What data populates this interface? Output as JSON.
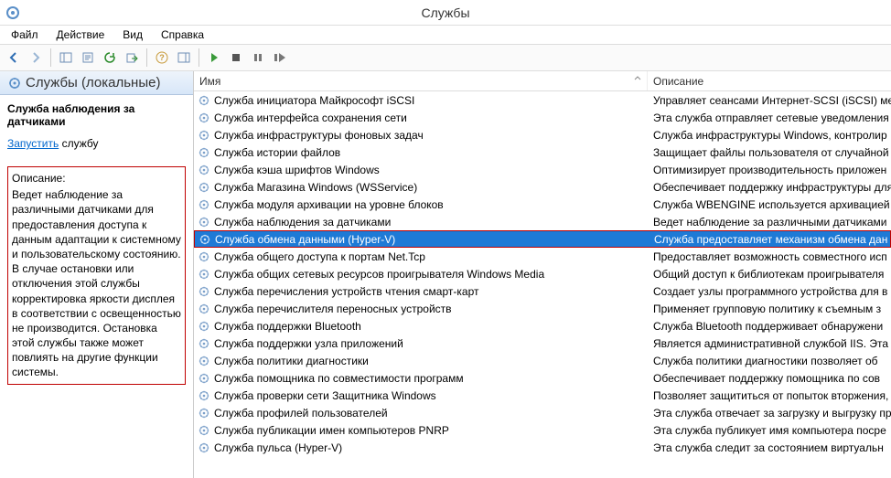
{
  "title": "Службы",
  "menu": {
    "file": "Файл",
    "action": "Действие",
    "view": "Вид",
    "help": "Справка"
  },
  "panel": {
    "header": "Службы (локальные)",
    "selected_title": "Служба наблюдения за датчиками",
    "start_link": "Запустить",
    "start_suffix": " службу",
    "desc_label": "Описание:",
    "desc_text": "Ведет наблюдение за различными датчиками для предоставления доступа к данным адаптации к системному и пользовательскому состоянию.  В случае остановки или отключения этой службы корректировка яркости дисплея в соответствии с освещенностью не производится. Остановка этой службы также может повлиять на другие функции системы."
  },
  "columns": {
    "name": "Имя",
    "desc": "Описание"
  },
  "selected_index": 8,
  "services": [
    {
      "name": "Служба инициатора Майкрософт iSCSI",
      "desc": "Управляет сеансами Интернет-SCSI (iSCSI) ме"
    },
    {
      "name": "Служба интерфейса сохранения сети",
      "desc": "Эта служба отправляет сетевые уведомления ("
    },
    {
      "name": "Служба инфраструктуры фоновых задач",
      "desc": "Служба инфраструктуры Windows, контролир"
    },
    {
      "name": "Служба истории файлов",
      "desc": "Защищает файлы пользователя от случайной"
    },
    {
      "name": "Служба кэша шрифтов Windows",
      "desc": "Оптимизирует производительность приложен"
    },
    {
      "name": "Служба Магазина Windows (WSService)",
      "desc": "Обеспечивает поддержку инфраструктуры для"
    },
    {
      "name": "Служба модуля архивации на уровне блоков",
      "desc": "Служба WBENGINE используется архивацией"
    },
    {
      "name": "Служба наблюдения за датчиками",
      "desc": "Ведет наблюдение за различными датчиками"
    },
    {
      "name": "Служба обмена данными (Hyper-V)",
      "desc": "Служба предоставляет механизм обмена дан"
    },
    {
      "name": "Служба общего доступа к портам Net.Tcp",
      "desc": "Предоставляет возможность совместного исп"
    },
    {
      "name": "Служба общих сетевых ресурсов проигрывателя Windows Media",
      "desc": "Общий доступ к библиотекам проигрывателя"
    },
    {
      "name": "Служба перечисления устройств чтения смарт-карт",
      "desc": "Создает узлы программного устройства для в"
    },
    {
      "name": "Служба перечислителя переносных устройств",
      "desc": "Применяет групповую политику к съемным з"
    },
    {
      "name": "Служба поддержки Bluetooth",
      "desc": "Служба Bluetooth поддерживает обнаружени"
    },
    {
      "name": "Служба поддержки узла приложений",
      "desc": "Является административной службой IIS. Эта"
    },
    {
      "name": "Служба политики диагностики",
      "desc": "Служба политики диагностики позволяет об"
    },
    {
      "name": "Служба помощника по совместимости программ",
      "desc": "Обеспечивает поддержку помощника по сов"
    },
    {
      "name": "Служба проверки сети Защитника Windows",
      "desc": "Позволяет защититься от попыток вторжения,"
    },
    {
      "name": "Служба профилей пользователей",
      "desc": "Эта служба отвечает за загрузку и выгрузку пр"
    },
    {
      "name": "Служба публикации имен компьютеров PNRP",
      "desc": "Эта служба публикует имя компьютера посре"
    },
    {
      "name": "Служба пульса (Hyper-V)",
      "desc": "Эта служба следит за состоянием виртуальн"
    }
  ]
}
